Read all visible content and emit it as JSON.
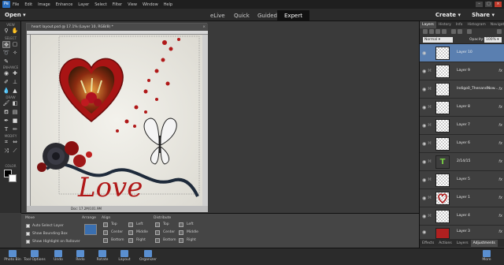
{
  "menu": [
    "File",
    "Edit",
    "Image",
    "Enhance",
    "Layer",
    "Select",
    "Filter",
    "View",
    "Window",
    "Help"
  ],
  "modebar": {
    "open": "Open",
    "tabs": [
      "eLive",
      "Quick",
      "Guided",
      "Expert"
    ],
    "active_tab": "Expert",
    "create": "Create",
    "share": "Share"
  },
  "toolbox": {
    "sections": [
      "VIEW",
      "SELECT",
      "ENHANCE",
      "DRAW",
      "MODIFY",
      "COLOR"
    ]
  },
  "document": {
    "title": "heart layout.psd @ 17.1% (Layer 10, RGB/8) *",
    "close": "×",
    "status": "Doc: 17.2M/101.9M",
    "love_text": "Love"
  },
  "panel": {
    "tabs": [
      "Layers",
      "History",
      "Info",
      "Histogram",
      "Navigator"
    ],
    "active_tab": "Layers",
    "blend_mode": "Normal",
    "opacity_label": "Opacity:",
    "opacity": "100%",
    "layers": [
      {
        "name": "Layer 10",
        "selected": true,
        "fx": false
      },
      {
        "name": "Layer 9",
        "selected": false,
        "fx": true
      },
      {
        "name": "Indigo0_ThenandNow...",
        "selected": false,
        "fx": true
      },
      {
        "name": "Layer 8",
        "selected": false,
        "fx": true
      },
      {
        "name": "Layer 7",
        "selected": false,
        "fx": true
      },
      {
        "name": "Layer 6",
        "selected": false,
        "fx": true
      },
      {
        "name": "2/14/15",
        "selected": false,
        "fx": true
      },
      {
        "name": "Layer 5",
        "selected": false,
        "fx": true
      },
      {
        "name": "Layer 1",
        "selected": false,
        "fx": true
      },
      {
        "name": "Layer 4",
        "selected": false,
        "fx": true
      },
      {
        "name": "Layer 3",
        "selected": false,
        "fx": true
      },
      {
        "name": "Background",
        "selected": false,
        "fx": false
      }
    ],
    "bottom_tabs": [
      "Effects",
      "Actions",
      "Layers",
      "Adjustments"
    ],
    "bottom_active": "Adjustments"
  },
  "options": {
    "tool_label": "Move",
    "checks": [
      {
        "label": "Auto Select Layer",
        "checked": true
      },
      {
        "label": "Show Bounding Box",
        "checked": true
      },
      {
        "label": "Show Highlight on Rollover",
        "checked": true
      }
    ],
    "arrange": "Arrange",
    "align": "Align",
    "align_items": [
      "Top",
      "Center",
      "Bottom",
      "Left",
      "Middle",
      "Right"
    ],
    "distribute": "Distribute",
    "distribute_items": [
      "Top",
      "Center",
      "Bottom",
      "Left",
      "Middle",
      "Right"
    ]
  },
  "bottombar": {
    "left": [
      "Photo Bin",
      "Tool Options",
      "Undo",
      "Redo",
      "Rotate",
      "Layout",
      "Organizer"
    ],
    "right": "More"
  },
  "colors": {
    "accent": "#5a7fb0",
    "heart": "#b01818",
    "ribbon": "#1e2a3a"
  }
}
